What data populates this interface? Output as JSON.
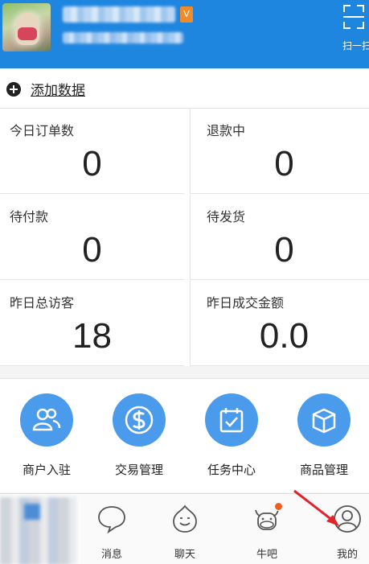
{
  "header": {
    "vip_badge": "V",
    "scan_label": "扫一扫"
  },
  "add_data": {
    "label": "添加数据"
  },
  "stats": [
    {
      "label": "今日订单数",
      "value": "0"
    },
    {
      "label": "退款中",
      "value": "0"
    },
    {
      "label": "待付款",
      "value": "0"
    },
    {
      "label": "待发货",
      "value": "0"
    },
    {
      "label": "昨日总访客",
      "value": "18"
    },
    {
      "label": "昨日成交金额",
      "value": "0.0"
    }
  ],
  "functions": [
    {
      "label": "商户入驻",
      "icon": "users-icon"
    },
    {
      "label": "交易管理",
      "icon": "dollar-icon"
    },
    {
      "label": "任务中心",
      "icon": "calendar-check-icon"
    },
    {
      "label": "商品管理",
      "icon": "box-icon"
    }
  ],
  "nav": [
    {
      "label": "消息",
      "icon": "message-icon"
    },
    {
      "label": "聊天",
      "icon": "chat-icon"
    },
    {
      "label": "牛吧",
      "icon": "cow-icon"
    },
    {
      "label": "我的",
      "icon": "user-icon"
    }
  ],
  "colors": {
    "header_bg": "#1f86e0",
    "function_circle": "#4a9bec",
    "badge_dot": "#f35a1e",
    "arrow": "#e0242b"
  }
}
